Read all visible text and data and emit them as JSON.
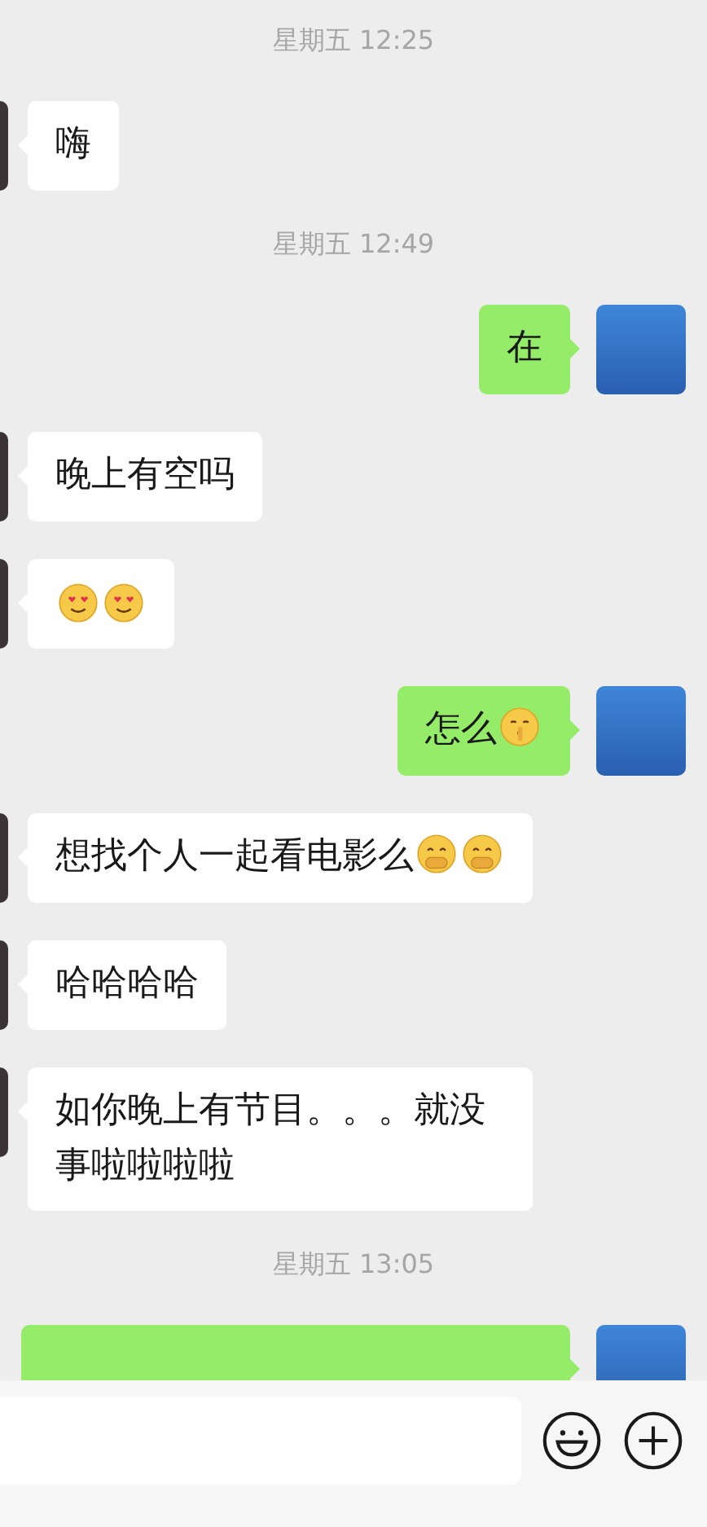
{
  "messages": [
    {
      "kind": "time",
      "text": "星期五 12:25"
    },
    {
      "kind": "received",
      "parts": [
        {
          "kind": "text",
          "text": "嗨"
        }
      ]
    },
    {
      "kind": "time",
      "text": "星期五 12:49"
    },
    {
      "kind": "sent",
      "parts": [
        {
          "kind": "text",
          "text": "在"
        }
      ]
    },
    {
      "kind": "received",
      "parts": [
        {
          "kind": "text",
          "text": "晚上有空吗"
        }
      ]
    },
    {
      "kind": "received",
      "parts": [
        {
          "kind": "emoji_love"
        },
        {
          "kind": "emoji_love"
        }
      ]
    },
    {
      "kind": "sent",
      "parts": [
        {
          "kind": "text",
          "text": "怎么"
        },
        {
          "kind": "emoji_shush"
        }
      ]
    },
    {
      "kind": "received",
      "parts": [
        {
          "kind": "text",
          "text": "想找个人一起看电影么"
        },
        {
          "kind": "emoji_giggle"
        },
        {
          "kind": "emoji_giggle"
        }
      ]
    },
    {
      "kind": "received",
      "parts": [
        {
          "kind": "text",
          "text": "哈哈哈哈"
        }
      ]
    },
    {
      "kind": "received",
      "parts": [
        {
          "kind": "text",
          "text": "如你晚上有节目。。。就没事啦啦啦啦"
        }
      ]
    },
    {
      "kind": "time",
      "text": "星期五 13:05"
    },
    {
      "kind": "sent"
    }
  ]
}
